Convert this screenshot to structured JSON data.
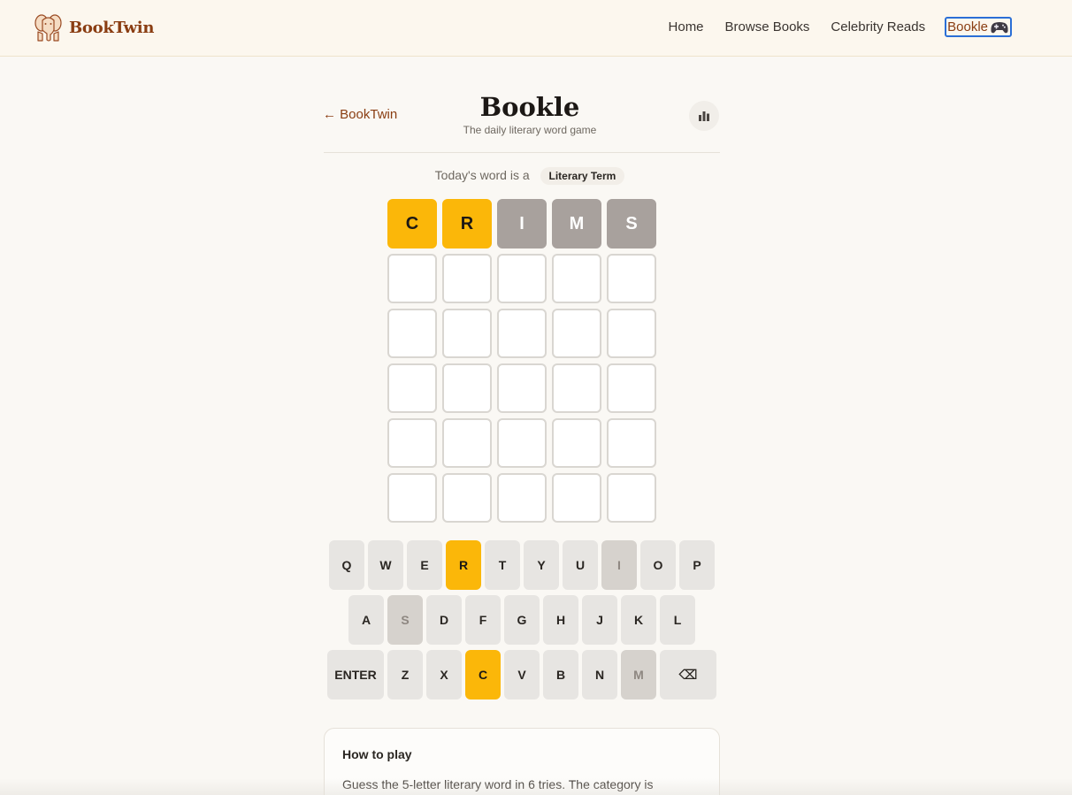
{
  "header": {
    "brand_name": "BookTwin",
    "nav": [
      {
        "label": "Home"
      },
      {
        "label": "Browse Books"
      },
      {
        "label": "Celebrity Reads"
      },
      {
        "label": "Bookle",
        "active": true
      }
    ]
  },
  "game": {
    "back_label": "← BookTwin",
    "title": "Bookle",
    "subtitle": "The daily literary word game",
    "category_prefix": "Today's word is a",
    "category": "Literary Term"
  },
  "board": {
    "rows": [
      [
        {
          "letter": "C",
          "state": "present"
        },
        {
          "letter": "R",
          "state": "present"
        },
        {
          "letter": "I",
          "state": "absent"
        },
        {
          "letter": "M",
          "state": "absent"
        },
        {
          "letter": "S",
          "state": "absent"
        }
      ],
      [
        {
          "letter": ""
        },
        {
          "letter": ""
        },
        {
          "letter": ""
        },
        {
          "letter": ""
        },
        {
          "letter": ""
        }
      ],
      [
        {
          "letter": ""
        },
        {
          "letter": ""
        },
        {
          "letter": ""
        },
        {
          "letter": ""
        },
        {
          "letter": ""
        }
      ],
      [
        {
          "letter": ""
        },
        {
          "letter": ""
        },
        {
          "letter": ""
        },
        {
          "letter": ""
        },
        {
          "letter": ""
        }
      ],
      [
        {
          "letter": ""
        },
        {
          "letter": ""
        },
        {
          "letter": ""
        },
        {
          "letter": ""
        },
        {
          "letter": ""
        }
      ],
      [
        {
          "letter": ""
        },
        {
          "letter": ""
        },
        {
          "letter": ""
        },
        {
          "letter": ""
        },
        {
          "letter": ""
        }
      ]
    ]
  },
  "keyboard": {
    "rows": [
      [
        {
          "label": "Q"
        },
        {
          "label": "W"
        },
        {
          "label": "E"
        },
        {
          "label": "R",
          "state": "present"
        },
        {
          "label": "T"
        },
        {
          "label": "Y"
        },
        {
          "label": "U"
        },
        {
          "label": "I",
          "state": "absent"
        },
        {
          "label": "O"
        },
        {
          "label": "P"
        }
      ],
      [
        {
          "label": "A"
        },
        {
          "label": "S",
          "state": "absent"
        },
        {
          "label": "D"
        },
        {
          "label": "F"
        },
        {
          "label": "G"
        },
        {
          "label": "H"
        },
        {
          "label": "J"
        },
        {
          "label": "K"
        },
        {
          "label": "L"
        }
      ],
      [
        {
          "label": "ENTER",
          "wide": true
        },
        {
          "label": "Z"
        },
        {
          "label": "X"
        },
        {
          "label": "C",
          "state": "present"
        },
        {
          "label": "V"
        },
        {
          "label": "B"
        },
        {
          "label": "N"
        },
        {
          "label": "M",
          "state": "absent"
        },
        {
          "label": "⌫",
          "wide": true,
          "icon": "backspace-icon"
        }
      ]
    ]
  },
  "help": {
    "title": "How to play",
    "text": "Guess the 5-letter literary word in 6 tries. The category is"
  },
  "colors": {
    "present": "#fbb709",
    "absent": "#a8a19d",
    "brand": "#8a3d12"
  }
}
